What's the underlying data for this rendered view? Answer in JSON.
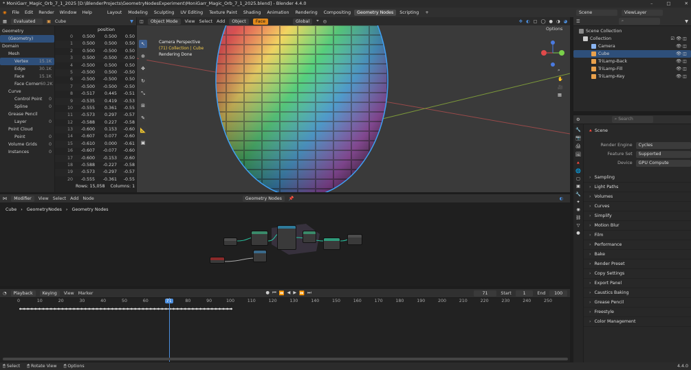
{
  "window": {
    "title": "* MoniGarr_Magic_Orb_7_1_2025 [D:\\BlenderProjects\\GeometryNodesExperiment\\MoniGarr_Magic_Orb_7_1_2025.blend] - Blender 4.4.0",
    "min": "–",
    "max": "□",
    "close": "✕"
  },
  "menu": [
    "File",
    "Edit",
    "Render",
    "Window",
    "Help"
  ],
  "workspaces": [
    "Layout",
    "Modeling",
    "Sculpting",
    "UV Editing",
    "Texture Paint",
    "Shading",
    "Animation",
    "Rendering",
    "Compositing",
    "Geometry Nodes",
    "Scripting"
  ],
  "active_workspace": "Geometry Nodes",
  "top_right": {
    "scene": "Scene",
    "viewlayer": "ViewLayer"
  },
  "spreadsheet": {
    "eval_mode": "Evaluated",
    "object": "Cube",
    "tree": [
      {
        "label": "Geometry",
        "count": "",
        "indent": 0,
        "icon": "geometry-icon"
      },
      {
        "label": "(Geometry)",
        "count": "",
        "indent": 1,
        "selected": true
      },
      {
        "label": "Domain",
        "count": "",
        "indent": 0
      },
      {
        "label": "Mesh",
        "count": "",
        "indent": 1
      },
      {
        "label": "Vertex",
        "count": "15.1K",
        "indent": 2,
        "selected": true
      },
      {
        "label": "Edge",
        "count": "30.1K",
        "indent": 2
      },
      {
        "label": "Face",
        "count": "15.1K",
        "indent": 2
      },
      {
        "label": "Face Corner",
        "count": "60.2K",
        "indent": 2
      },
      {
        "label": "Curve",
        "count": "",
        "indent": 1
      },
      {
        "label": "Control Point",
        "count": "0",
        "indent": 2
      },
      {
        "label": "Spline",
        "count": "0",
        "indent": 2
      },
      {
        "label": "Grease Pencil",
        "count": "",
        "indent": 1
      },
      {
        "label": "Layer",
        "count": "0",
        "indent": 2
      },
      {
        "label": "Point Cloud",
        "count": "",
        "indent": 1
      },
      {
        "label": "Point",
        "count": "0",
        "indent": 2
      },
      {
        "label": "Volume Grids",
        "count": "0",
        "indent": 1
      },
      {
        "label": "Instances",
        "count": "0",
        "indent": 1
      }
    ],
    "column_header": "position",
    "rows": [
      [
        "0",
        "0.500",
        "0.500",
        "0.50"
      ],
      [
        "1",
        "0.500",
        "0.500",
        "0.50"
      ],
      [
        "2",
        "0.500",
        "-0.500",
        "0.50"
      ],
      [
        "3",
        "0.500",
        "-0.500",
        "-0.50"
      ],
      [
        "4",
        "-0.500",
        "0.500",
        "0.50"
      ],
      [
        "5",
        "-0.500",
        "0.500",
        "-0.50"
      ],
      [
        "6",
        "-0.500",
        "-0.500",
        "0.50"
      ],
      [
        "7",
        "-0.500",
        "-0.500",
        "-0.50"
      ],
      [
        "8",
        "-0.517",
        "0.445",
        "-0.51"
      ],
      [
        "9",
        "-0.535",
        "0.419",
        "-0.53"
      ],
      [
        "10",
        "-0.555",
        "0.361",
        "-0.55"
      ],
      [
        "11",
        "-0.573",
        "0.297",
        "-0.57"
      ],
      [
        "12",
        "-0.588",
        "0.227",
        "-0.58"
      ],
      [
        "13",
        "-0.600",
        "0.153",
        "-0.60"
      ],
      [
        "14",
        "-0.607",
        "0.077",
        "-0.60"
      ],
      [
        "15",
        "-0.610",
        "0.000",
        "-0.61"
      ],
      [
        "16",
        "-0.607",
        "-0.077",
        "-0.60"
      ],
      [
        "17",
        "-0.600",
        "-0.153",
        "-0.60"
      ],
      [
        "18",
        "-0.588",
        "-0.227",
        "-0.58"
      ],
      [
        "19",
        "-0.573",
        "-0.297",
        "-0.57"
      ],
      [
        "20",
        "-0.555",
        "-0.361",
        "-0.55"
      ]
    ],
    "footer_rows": "Rows: 15,058",
    "footer_cols": "Columns: 1"
  },
  "viewport": {
    "mode": "Object Mode",
    "menus": [
      "View",
      "Select",
      "Add",
      "Object",
      "Face"
    ],
    "orientation": "Global",
    "options": "Options",
    "overlay_line1": "Camera Perspective",
    "overlay_line2": "(71) Collection | Cube",
    "overlay_line3": "Rendering Done"
  },
  "outliner": {
    "root": "Scene Collection",
    "collection": "Collection",
    "items": [
      "Camera",
      "Cube",
      "TriLamp-Back",
      "TriLamp-Fill",
      "TriLamp-Key"
    ],
    "selected": "Cube"
  },
  "properties": {
    "scene_label": "Scene",
    "search_placeholder": "Search",
    "fields": [
      {
        "label": "Render Engine",
        "value": "Cycles"
      },
      {
        "label": "Feature Set",
        "value": "Supported"
      },
      {
        "label": "Device",
        "value": "GPU Compute"
      }
    ],
    "sections": [
      "Sampling",
      "Light Paths",
      "Volumes",
      "Curves",
      "Simplify",
      "Motion Blur",
      "Film",
      "Performance",
      "Bake",
      "Render Preset",
      "Copy Settings",
      "Export Panel",
      "Caustics Baking",
      "Grease Pencil",
      "Freestyle",
      "Color Management"
    ]
  },
  "node_editor": {
    "menus": [
      "Modifier",
      "View",
      "Select",
      "Add",
      "Node"
    ],
    "tree_name": "Geometry Nodes",
    "breadcrumb": [
      "Cube",
      "GeometryNodes",
      "Geometry Nodes"
    ]
  },
  "timeline": {
    "menus": [
      "Playback",
      "Keying",
      "View",
      "Marker"
    ],
    "current_frame": "71",
    "start_label": "Start",
    "start": "1",
    "end_label": "End",
    "end": "100",
    "ticks": [
      "0",
      "10",
      "20",
      "30",
      "40",
      "50",
      "60",
      "71",
      "80",
      "90",
      "100",
      "110",
      "120",
      "130",
      "140",
      "150",
      "160",
      "170",
      "180",
      "190",
      "200",
      "210",
      "220",
      "230",
      "240",
      "250"
    ]
  },
  "status": {
    "select": "Select",
    "rotate": "Rotate View",
    "options": "Options",
    "version": "4.4.0"
  }
}
